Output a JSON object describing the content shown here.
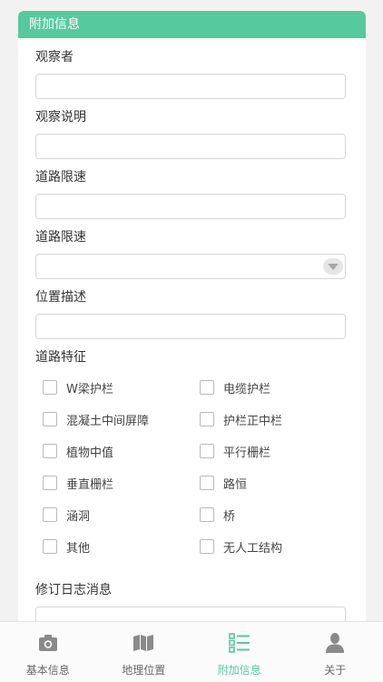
{
  "card": {
    "title": "附加信息"
  },
  "form": {
    "observer_label": "观察者",
    "observer_value": "",
    "observation_desc_label": "观察说明",
    "observation_desc_value": "",
    "speed_limit_label": "道路限速",
    "speed_limit_value": "",
    "speed_limit_select_label": "道路限速",
    "speed_limit_select_value": "",
    "location_desc_label": "位置描述",
    "location_desc_value": "",
    "road_features_label": "道路特征",
    "road_features": [
      {
        "label": "W梁护栏",
        "checked": false
      },
      {
        "label": "电缆护栏",
        "checked": false
      },
      {
        "label": "混凝土中间屏障",
        "checked": false
      },
      {
        "label": "护栏正中栏",
        "checked": false
      },
      {
        "label": "植物中值",
        "checked": false
      },
      {
        "label": "平行栅栏",
        "checked": false
      },
      {
        "label": "垂直栅栏",
        "checked": false
      },
      {
        "label": "路恒",
        "checked": false
      },
      {
        "label": "涵洞",
        "checked": false
      },
      {
        "label": "桥",
        "checked": false
      },
      {
        "label": "其他",
        "checked": false
      },
      {
        "label": "无人工结构",
        "checked": false
      }
    ],
    "revision_log_label": "修订日志消息",
    "revision_log_value": ""
  },
  "tabbar": {
    "items": [
      {
        "label": "基本信息",
        "icon": "camera-icon",
        "active": false
      },
      {
        "label": "地理位置",
        "icon": "map-icon",
        "active": false
      },
      {
        "label": "附加信息",
        "icon": "list-icon",
        "active": true
      },
      {
        "label": "关于",
        "icon": "person-icon",
        "active": false
      }
    ]
  },
  "colors": {
    "accent": "#57c99e",
    "background": "#f2f2f2",
    "border": "#d6d6d6"
  }
}
